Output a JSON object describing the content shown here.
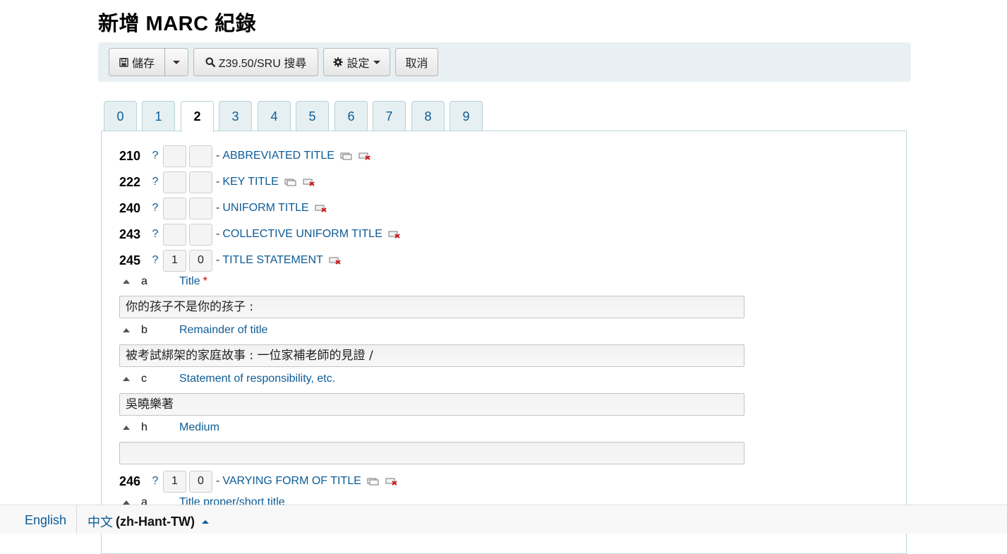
{
  "page": {
    "title": "新增 MARC 紀錄"
  },
  "toolbar": {
    "save_label": "儲存",
    "z3950_label": "Z39.50/SRU 搜尋",
    "settings_label": "設定",
    "cancel_label": "取消"
  },
  "tabs": [
    {
      "label": "0",
      "active": false
    },
    {
      "label": "1",
      "active": false
    },
    {
      "label": "2",
      "active": true
    },
    {
      "label": "3",
      "active": false
    },
    {
      "label": "4",
      "active": false
    },
    {
      "label": "5",
      "active": false
    },
    {
      "label": "6",
      "active": false
    },
    {
      "label": "7",
      "active": false
    },
    {
      "label": "8",
      "active": false
    },
    {
      "label": "9",
      "active": false
    }
  ],
  "fields": {
    "f210": {
      "tag": "210",
      "help": "?",
      "ind1": "",
      "ind2": "",
      "dash": "-",
      "label": "ABBREVIATED TITLE"
    },
    "f222": {
      "tag": "222",
      "help": "?",
      "ind1": "",
      "ind2": "",
      "dash": "-",
      "label": "KEY TITLE"
    },
    "f240": {
      "tag": "240",
      "help": "?",
      "ind1": "",
      "ind2": "",
      "dash": "-",
      "label": "UNIFORM TITLE"
    },
    "f243": {
      "tag": "243",
      "help": "?",
      "ind1": "",
      "ind2": "",
      "dash": "-",
      "label": "COLLECTIVE UNIFORM TITLE"
    },
    "f245": {
      "tag": "245",
      "help": "?",
      "ind1": "1",
      "ind2": "0",
      "dash": "-",
      "label": "TITLE STATEMENT",
      "subfields": {
        "a": {
          "code": "a",
          "label": "Title",
          "required": "*",
          "value": "你的孩子不是你的孩子 :"
        },
        "b": {
          "code": "b",
          "label": "Remainder of title",
          "value": "被考試綁架的家庭故事 : 一位家補老師的見證 /"
        },
        "c": {
          "code": "c",
          "label": "Statement of responsibility, etc.",
          "value": "吳曉樂著"
        },
        "h": {
          "code": "h",
          "label": "Medium",
          "value": ""
        }
      }
    },
    "f246": {
      "tag": "246",
      "help": "?",
      "ind1": "1",
      "ind2": "0",
      "dash": "-",
      "label": "VARYING FORM OF TITLE",
      "subfields": {
        "a": {
          "code": "a",
          "label": "Title proper/short title"
        }
      }
    }
  },
  "footer": {
    "lang_english": "English",
    "lang_current_script": "中文",
    "lang_current_code": "(zh-Hant-TW)"
  },
  "icons": {
    "save": "floppy-disk-icon",
    "search": "search-icon",
    "settings": "gear-icon",
    "repeat": "repeat-field-icon",
    "delete": "delete-field-icon",
    "collapse": "collapse-arrow-icon"
  },
  "colors": {
    "link": "#0d5c96",
    "toolbar_bg": "#e9f0f3",
    "tab_bg": "#e6f0f2",
    "required": "#cc0000"
  }
}
